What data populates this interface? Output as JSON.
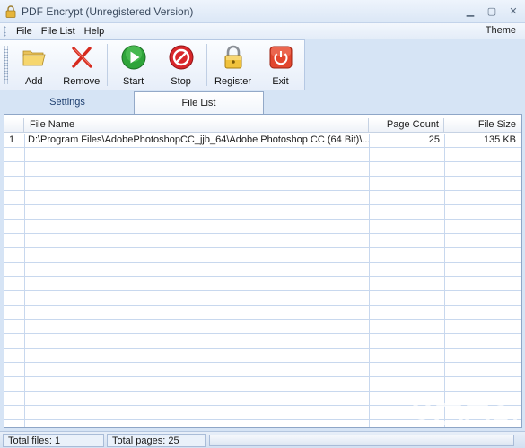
{
  "window": {
    "title": "PDF Encrypt (Unregistered Version)"
  },
  "menu": {
    "file": "File",
    "file_list": "File List",
    "help": "Help",
    "theme": "Theme"
  },
  "toolbar": {
    "add": "Add",
    "remove": "Remove",
    "start": "Start",
    "stop": "Stop",
    "register": "Register",
    "exit": "Exit"
  },
  "tabs": {
    "settings": "Settings",
    "file_list": "File List",
    "active": "file_list"
  },
  "table": {
    "columns": {
      "num": "",
      "file_name": "File Name",
      "page_count": "Page Count",
      "file_size": "File Size"
    },
    "rows": [
      {
        "num": "1",
        "file_name": "D:\\Program Files\\AdobePhotoshopCC_jjb_64\\Adobe Photoshop CC (64 Bit)\\...",
        "page_count": "25",
        "file_size": "135 KB"
      }
    ]
  },
  "status": {
    "total_files": "Total files: 1",
    "total_pages": "Total pages: 25"
  },
  "colors": {
    "chrome": "#d6e4f5",
    "accent_text": "#1c3d6e",
    "grid_line": "#c8d8ee"
  }
}
